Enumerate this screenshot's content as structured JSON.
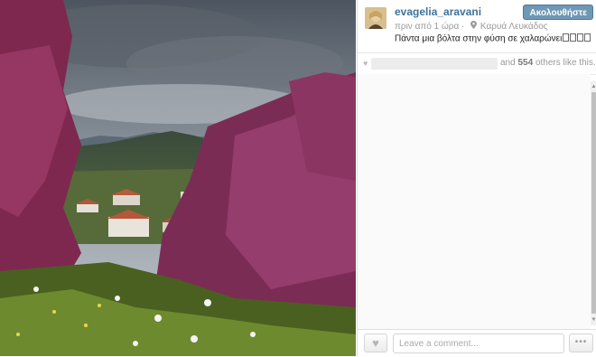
{
  "post": {
    "username": "evagelia_aravani",
    "follow_label": "Ακολουθήστε",
    "time_ago": "πριν από 1 ώρα",
    "separator": "·",
    "location": "Καρυά Λευκάδος",
    "caption": "Πάντα μια βόλτα στην φύση σε χαλαρώνει"
  },
  "likes": {
    "others_prefix": "and",
    "others_count": "554",
    "others_suffix": "others like this."
  },
  "comment_box": {
    "placeholder": "Leave a comment..."
  },
  "icons": {
    "location": "map-pin-icon",
    "like": "heart-icon",
    "more": "ellipsis-icon"
  },
  "colors": {
    "username": "#3f729b",
    "follow_button": "#6f97b6",
    "meta_text": "#999999"
  }
}
